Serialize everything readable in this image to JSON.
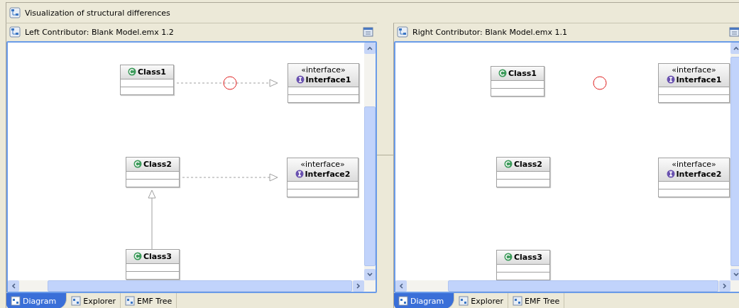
{
  "view": {
    "title": "Visualization of structural differences"
  },
  "panels": [
    {
      "title": "Left Contributor: Blank Model.emx 1.2",
      "nodes": [
        {
          "kind": "class",
          "name": "Class1"
        },
        {
          "kind": "interface",
          "stereotype": "«interface»",
          "name": "Interface1"
        },
        {
          "kind": "class",
          "name": "Class2"
        },
        {
          "kind": "interface",
          "stereotype": "«interface»",
          "name": "Interface2"
        },
        {
          "kind": "class",
          "name": "Class3"
        }
      ],
      "connectors": [
        {
          "kind": "realization"
        },
        {
          "kind": "realization"
        },
        {
          "kind": "generalization"
        }
      ],
      "tabs": [
        {
          "label": "Diagram",
          "selected": true
        },
        {
          "label": "Explorer",
          "selected": false
        },
        {
          "label": "EMF Tree",
          "selected": false
        }
      ]
    },
    {
      "title": "Right Contributor: Blank Model.emx 1.1",
      "nodes": [
        {
          "kind": "class",
          "name": "Class1"
        },
        {
          "kind": "interface",
          "stereotype": "«interface»",
          "name": "Interface1"
        },
        {
          "kind": "class",
          "name": "Class2"
        },
        {
          "kind": "interface",
          "stereotype": "«interface»",
          "name": "Interface2"
        },
        {
          "kind": "class",
          "name": "Class3"
        }
      ],
      "tabs": [
        {
          "label": "Diagram",
          "selected": true
        },
        {
          "label": "Explorer",
          "selected": false
        },
        {
          "label": "EMF Tree",
          "selected": false
        }
      ]
    }
  ]
}
